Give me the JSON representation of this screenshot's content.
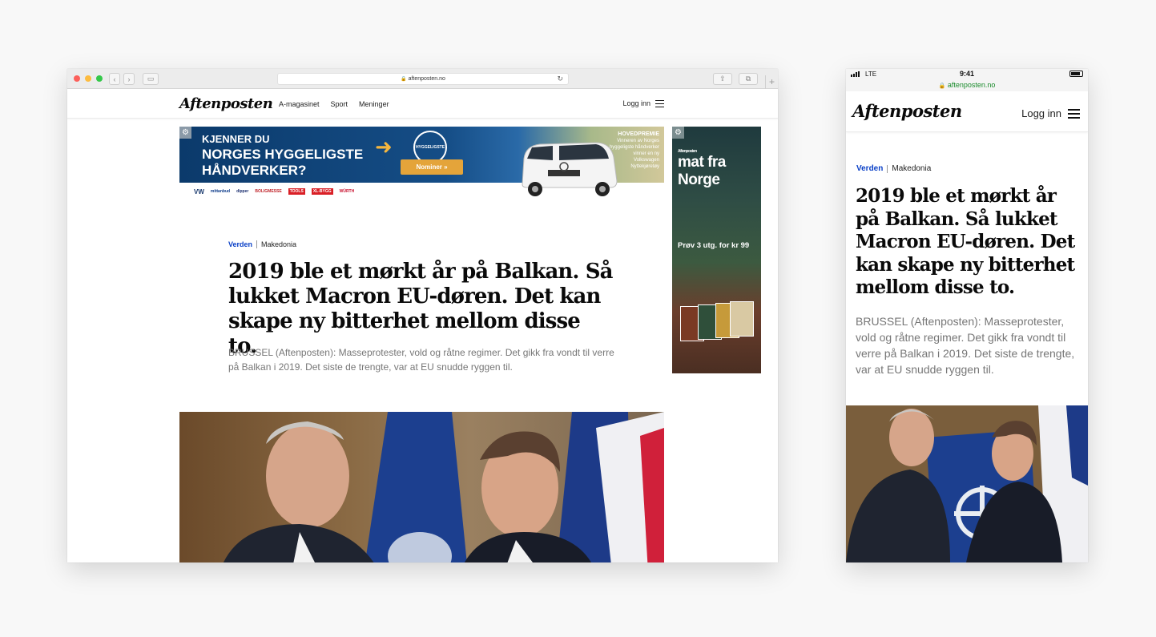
{
  "desktop": {
    "address": "aftenposten.no",
    "logo": "Aftenposten",
    "nav": [
      "A-magasinet",
      "Sport",
      "Meninger"
    ],
    "login": "Logg inn",
    "ad_banner": {
      "line1": "KJENNER DU",
      "line2": "NORGES HYGGELIGSTE HÅNDVERKER?",
      "seal": "HYGGELIGSTE",
      "button": "Nominer »",
      "prize_title": "HOVEDPREMIE",
      "prize_text": "Vinneren av Norges hyggeligste håndverker vinner en ny Volkswagen Nyttekjøretøy",
      "partners": [
        "VW",
        "mittanbud",
        "dipper",
        "BOLIGMESSE",
        "TOOLS",
        "XL-BYGG",
        "WÜRTH"
      ]
    },
    "ad_side": {
      "brand": "mat fra Norge",
      "brand_small": "Aftenposten",
      "offer": "Prøv 3 utg. for kr 99"
    },
    "section": "Verden",
    "tag": "Makedonia",
    "headline": "2019 ble et mørkt år på Balkan. Så lukket Macron EU-døren. Det kan skape ny bitterhet mellom disse to.",
    "lead": "BRUSSEL (Aftenposten): Masseprotester, vold og råtne regimer. Det gikk fra vondt til verre på Balkan i 2019. Det siste de trengte, var at EU snudde ryggen til."
  },
  "mobile": {
    "carrier": "LTE",
    "time": "9:41",
    "url": "aftenposten.no",
    "logo": "Aftenposten",
    "login": "Logg inn",
    "section": "Verden",
    "tag": "Makedonia",
    "headline": "2019 ble et mørkt år på Balkan. Så lukket Macron EU-døren. Det kan skape ny bitterhet mellom disse to.",
    "lead": "BRUSSEL (Aftenposten): Masseprotester, vold og råtne regimer. Det gikk fra vondt til verre på Balkan i 2019. Det siste de trengte, var at EU snudde ryggen til."
  },
  "colors": {
    "section_blue": "#0a40c7",
    "lock_green": "#1a8b2c",
    "ad_button": "#e4a43a"
  }
}
